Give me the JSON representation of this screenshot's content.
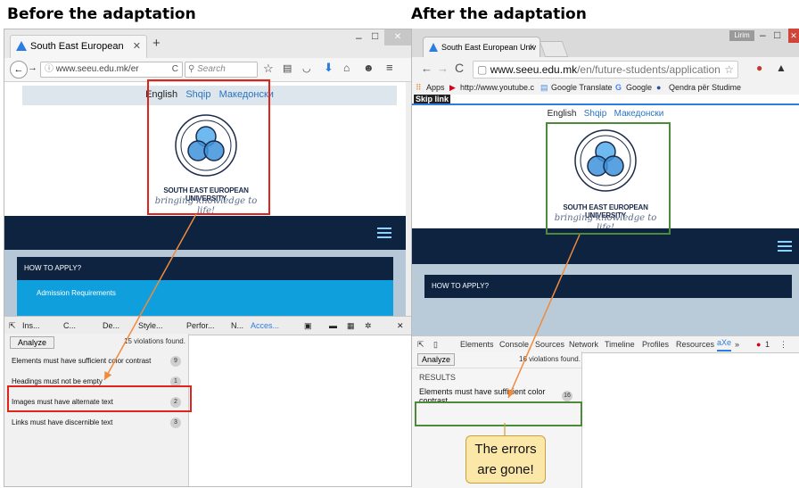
{
  "headings": {
    "before": "Before the adaptation",
    "after": "After the adaptation"
  },
  "left_browser": {
    "tab_title": "South East European Univ...",
    "tab_close": "✕",
    "new_tab": "+",
    "url": "www.seeu.edu.mk/er",
    "search_placeholder": "Search",
    "win_min": "–",
    "win_max": "□",
    "win_close": "✕",
    "languages": {
      "english": "English",
      "albanian": "Shqip",
      "macedonian": "Македонски"
    },
    "logo_name": "SOUTH EAST EUROPEAN UNIVERSITY",
    "logo_tagline": "bringing knowledge to life!",
    "menu": {
      "how_to_apply": "HOW TO APPLY?",
      "admission": "Admission Requirements"
    },
    "devtools": {
      "tabs": [
        "Ins...",
        "C...",
        "De...",
        "Style...",
        "Perfor...",
        "N...",
        "Acces..."
      ],
      "analyze_label": "Analyze",
      "violations_summary": "15 violations found.",
      "violations": [
        {
          "label": "Elements must have sufficient color contrast",
          "count": "9"
        },
        {
          "label": "Headings must not be empty",
          "count": "1"
        },
        {
          "label": "Images must have alternate text",
          "count": "2"
        },
        {
          "label": "Links must have discernible text",
          "count": "3"
        }
      ]
    }
  },
  "right_browser": {
    "tab_title": "South East European Univ",
    "tab_close": "✕",
    "user_chip": "Lirim",
    "win_min": "–",
    "win_max": "□",
    "win_close": "✕",
    "url_host": "www.seeu.edu.mk",
    "url_path": "/en/future-students/application",
    "bookmarks": [
      "Apps",
      "http://www.youtube.c",
      "Google Translate",
      "Google",
      "Qendra për Studime"
    ],
    "skip_link": "Skip link",
    "languages": {
      "english": "English",
      "albanian": "Shqip",
      "macedonian": "Македонски"
    },
    "logo_name": "SOUTH EAST EUROPEAN UNIVERSITY",
    "logo_tagline": "bringing knowledge to life!",
    "menu": {
      "how_to_apply": "HOW TO APPLY?"
    },
    "devtools": {
      "tabs": [
        "Elements",
        "Console",
        "Sources",
        "Network",
        "Timeline",
        "Profiles",
        "Resources",
        "aXe",
        "»"
      ],
      "error_count": "1",
      "analyze_label": "Analyze",
      "violations_summary": "16 violations found.",
      "results_header": "RESULTS",
      "violations": [
        {
          "label": "Elements must have sufficient color contrast",
          "count": "16"
        }
      ]
    }
  },
  "callout": {
    "line1": "The errors",
    "line2": "are gone!"
  },
  "colors": {
    "highlight_red": "#e0241c",
    "highlight_green": "#4f8a3a",
    "arrow": "#f08a3c",
    "navy": "#0e2340",
    "menu_blue": "#0f9fdc"
  }
}
